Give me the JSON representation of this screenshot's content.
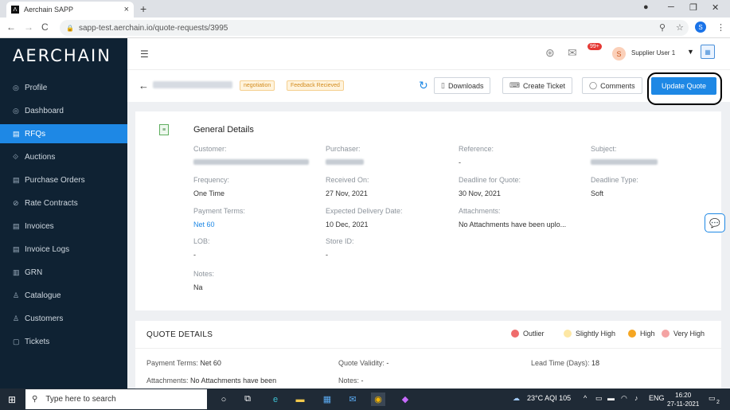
{
  "browser": {
    "tab_title": "Aerchain SAPP",
    "tab_close": "×",
    "new_tab": "+",
    "url": "sapp-test.aerchain.io/quote-requests/3995",
    "profile_initial": "S"
  },
  "sidebar": {
    "logo": "AERCHAIN",
    "items": [
      {
        "label": "Profile",
        "icon": "◎"
      },
      {
        "label": "Dashboard",
        "icon": "◎"
      },
      {
        "label": "RFQs",
        "icon": "▤"
      },
      {
        "label": "Auctions",
        "icon": "⟐"
      },
      {
        "label": "Purchase Orders",
        "icon": "▤"
      },
      {
        "label": "Rate Contracts",
        "icon": "⊘"
      },
      {
        "label": "Invoices",
        "icon": "▤"
      },
      {
        "label": "Invoice Logs",
        "icon": "▤"
      },
      {
        "label": "GRN",
        "icon": "▥"
      },
      {
        "label": "Catalogue",
        "icon": "♙"
      },
      {
        "label": "Customers",
        "icon": "♙"
      },
      {
        "label": "Tickets",
        "icon": "▢"
      }
    ],
    "active_index": 2
  },
  "header": {
    "notification_badge": "99+",
    "user_initial": "S",
    "user_name": "Supplier User 1"
  },
  "toolbar": {
    "tags": [
      "negotiation",
      "Feedback Recieved"
    ],
    "downloads_label": "Downloads",
    "create_ticket_label": "Create Ticket",
    "comments_label": "Comments",
    "update_quote_label": "Update Quote"
  },
  "general_details": {
    "title": "General Details",
    "fields": {
      "customer_label": "Customer:",
      "purchaser_label": "Purchaser:",
      "reference_label": "Reference:",
      "reference_value": "-",
      "subject_label": "Subject:",
      "frequency_label": "Frequency:",
      "frequency_value": "One Time",
      "received_on_label": "Received On:",
      "received_on_value": "27 Nov, 2021",
      "deadline_quote_label": "Deadline for Quote:",
      "deadline_quote_value": "30 Nov, 2021",
      "deadline_type_label": "Deadline Type:",
      "deadline_type_value": "Soft",
      "payment_terms_label": "Payment Terms:",
      "payment_terms_value": "Net 60",
      "expected_delivery_label": "Expected Delivery Date:",
      "expected_delivery_value": "10 Dec, 2021",
      "attachments_label": "Attachments:",
      "attachments_value": "No Attachments have been uplo...",
      "lob_label": "LOB:",
      "lob_value": "-",
      "store_id_label": "Store ID:",
      "store_id_value": "-",
      "notes_label": "Notes:",
      "notes_value": "Na"
    }
  },
  "quote_details": {
    "title": "QUOTE DETAILS",
    "legend": [
      {
        "label": "Outlier",
        "color": "#ef6c6c"
      },
      {
        "label": "Slightly High",
        "color": "#fde7a4"
      },
      {
        "label": "High",
        "color": "#f5a623"
      },
      {
        "label": "Very High",
        "color": "#f4a3a3"
      }
    ],
    "payment_terms_label": "Payment Terms:",
    "payment_terms_value": "Net 60",
    "quote_validity_label": "Quote Validity:",
    "quote_validity_value": "-",
    "lead_time_label": "Lead Time (Days):",
    "lead_time_value": "18",
    "attachments_label": "Attachments:",
    "attachments_value": "No Attachments have been",
    "notes_label": "Notes:",
    "notes_value": "-"
  },
  "taskbar": {
    "search_placeholder": "Type here to search",
    "weather": "23°C AQI 105",
    "lang": "ENG",
    "time": "16:20",
    "date": "27-11-2021",
    "notif_count": "2"
  }
}
